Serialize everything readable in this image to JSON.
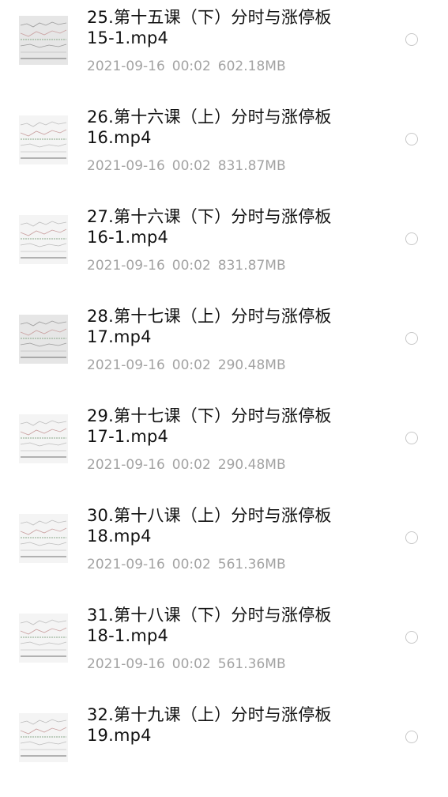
{
  "files": [
    {
      "title_line1": "25.第十五课（下）分时与涨停板",
      "title_line2": "15-1.mp4",
      "date": "2021-09-16",
      "time": "00:02",
      "size": "602.18MB",
      "thumb_style": "dark",
      "thumb_icon": "video-thumbnail-chart-icon"
    },
    {
      "title_line1": "26.第十六课（上）分时与涨停板",
      "title_line2": "16.mp4",
      "date": "2021-09-16",
      "time": "00:02",
      "size": "831.87MB",
      "thumb_style": "light",
      "thumb_icon": "video-thumbnail-chart-icon"
    },
    {
      "title_line1": "27.第十六课（下）分时与涨停板",
      "title_line2": "16-1.mp4",
      "date": "2021-09-16",
      "time": "00:02",
      "size": "831.87MB",
      "thumb_style": "light",
      "thumb_icon": "video-thumbnail-chart-icon"
    },
    {
      "title_line1": "28.第十七课（上）分时与涨停板",
      "title_line2": "17.mp4",
      "date": "2021-09-16",
      "time": "00:02",
      "size": "290.48MB",
      "thumb_style": "dark",
      "thumb_icon": "video-thumbnail-chart-icon"
    },
    {
      "title_line1": "29.第十七课（下）分时与涨停板",
      "title_line2": "17-1.mp4",
      "date": "2021-09-16",
      "time": "00:02",
      "size": "290.48MB",
      "thumb_style": "light",
      "thumb_icon": "video-thumbnail-chart-icon"
    },
    {
      "title_line1": "30.第十八课（上）分时与涨停板",
      "title_line2": "18.mp4",
      "date": "2021-09-16",
      "time": "00:02",
      "size": "561.36MB",
      "thumb_style": "light",
      "thumb_icon": "video-thumbnail-chart-icon"
    },
    {
      "title_line1": "31.第十八课（下）分时与涨停板",
      "title_line2": "18-1.mp4",
      "date": "2021-09-16",
      "time": "00:02",
      "size": "561.36MB",
      "thumb_style": "light",
      "thumb_icon": "video-thumbnail-chart-icon"
    },
    {
      "title_line1": "32.第十九课（上）分时与涨停板",
      "title_line2": "19.mp4",
      "date": "",
      "time": "",
      "size": "",
      "thumb_style": "light",
      "thumb_icon": "video-thumbnail-chart-icon"
    }
  ],
  "colors": {
    "title": "#111111",
    "meta": "#a3a3a3",
    "radio_border": "#c8c8c8",
    "background": "#ffffff"
  }
}
